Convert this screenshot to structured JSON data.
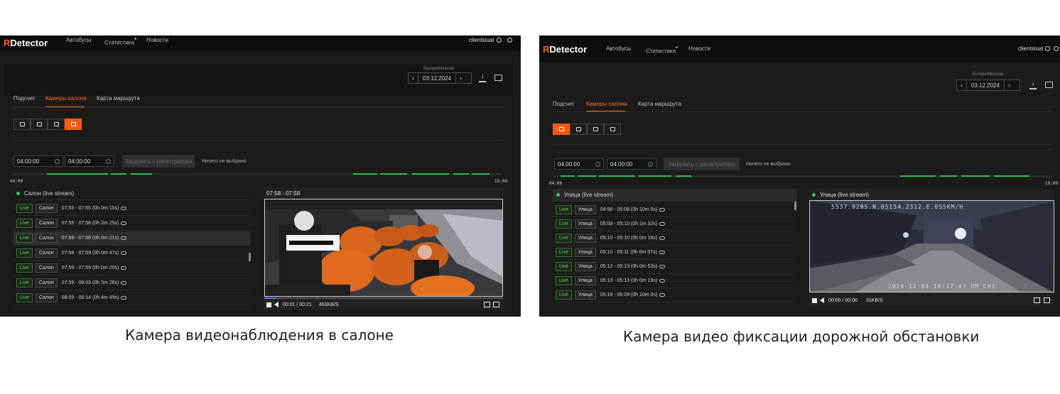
{
  "left": {
    "brand": {
      "first": "R",
      "rest": "Detector"
    },
    "nav": [
      "Автобусы",
      "Статистика",
      "Новости"
    ],
    "nav_star": "*",
    "user": "clientsiuat",
    "timezone": "Europe/Moscow",
    "date": "03.12.2024",
    "tabs": [
      "Подсчет",
      "Камеры салона",
      "Карта маршрута"
    ],
    "active_tab": 1,
    "camera_buttons_active": 3,
    "time_from": "04:00:00",
    "time_to": "04:00:00",
    "load_button": "Загрузить с регистратора",
    "nothing_selected": "Ничего не выбрано",
    "timeline_start": "04:00",
    "timeline_end": "19:00",
    "list_title": "Салон (live stream)",
    "rows": [
      {
        "live": "Live",
        "cam": "Салон",
        "text": "07:55 - 07:55 (0h 0m 15s)"
      },
      {
        "live": "Live",
        "cam": "Салон",
        "text": "07:55 - 07:58 (0h 2m 25s)"
      },
      {
        "live": "Live",
        "cam": "Салон",
        "text": "07:58 - 07:58 (0h 0m 21s)"
      },
      {
        "live": "Live",
        "cam": "Салон",
        "text": "07:58 - 07:59 (0h 0m 47s)"
      },
      {
        "live": "Live",
        "cam": "Салон",
        "text": "07:59 - 07:59 (0h 0m 20s)"
      },
      {
        "live": "Live",
        "cam": "Салон",
        "text": "07:59 - 08:03 (0h 3m 26s)"
      },
      {
        "live": "Live",
        "cam": "Салон",
        "text": "08:09 - 08:14 (0h 4m 49s)"
      }
    ],
    "selected_row": 2,
    "player_title": "07:58 - 07:58",
    "player_time": "00:01 / 00:21",
    "player_rate": "463KB/S",
    "caption": "Камера видеонаблюдения в салоне"
  },
  "right": {
    "brand": {
      "first": "R",
      "rest": "Detector"
    },
    "nav": [
      "Автобусы",
      "Статистика",
      "Новости"
    ],
    "nav_star": "*",
    "user": "clientsiuat",
    "timezone": "Europe/Moscow",
    "date": "03.12.2024",
    "tabs": [
      "Подсчет",
      "Камеры салона",
      "Карта маршрута"
    ],
    "active_tab": 1,
    "camera_buttons_active": 0,
    "time_from": "04:00:00",
    "time_to": "04:00:00",
    "load_button": "Загрузить с регистратора",
    "nothing_selected": "Ничего не выбрано",
    "timeline_start": "04:00",
    "timeline_end": "19:00",
    "list_title": "Улица (live stream)",
    "rows": [
      {
        "live": "Live",
        "cam": "Улица",
        "text": "04:58 - 05:08 (0h 10m 0s)"
      },
      {
        "live": "Live",
        "cam": "Улица",
        "text": "05:08 - 05:10 (0h 1m 32s)"
      },
      {
        "live": "Live",
        "cam": "Улица",
        "text": "05:10 - 05:10 (0h 0m 18s)"
      },
      {
        "live": "Live",
        "cam": "Улица",
        "text": "05:10 - 05:11 (0h 0m 57s)"
      },
      {
        "live": "Live",
        "cam": "Улица",
        "text": "05:12 - 05:13 (0h 0m 53s)"
      },
      {
        "live": "Live",
        "cam": "Улица",
        "text": "05:13 - 05:13 (0h 0m 19s)"
      },
      {
        "live": "Live",
        "cam": "Улица",
        "text": "05:19 - 05:29 (0h 10m 0s)"
      }
    ],
    "selected_row": -1,
    "player_title": "Улица (live stream)",
    "player_time": "00:00 / 00:00",
    "player_rate": "31KB/S",
    "osd_top": "5537.02B5.N.05154.2312.E.055KM/H",
    "osd_bottom": "2024-12-04  16:17:47  OM    CH3",
    "caption": "Камера видео фиксации дорожной обстановки"
  },
  "colors": {
    "accent": "#ff5a12",
    "live_green": "#39c74a",
    "background": "#1b1b1b"
  }
}
